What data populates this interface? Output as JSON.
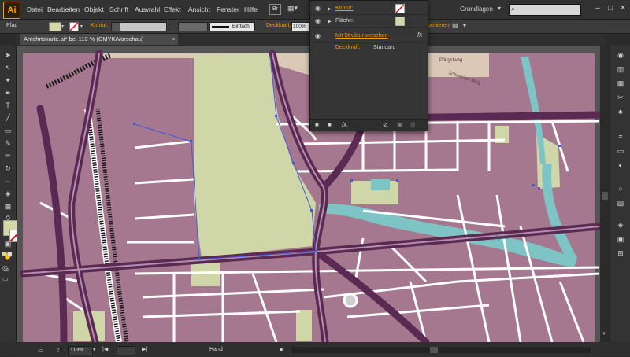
{
  "app": {
    "logo": "Ai"
  },
  "menu": {
    "items": [
      "Datei",
      "Bearbeiten",
      "Objekt",
      "Schrift",
      "Auswahl",
      "Effekt",
      "Ansicht",
      "Fenster",
      "Hilfe"
    ],
    "br_button": "Br",
    "workspace": "Grundlagen",
    "search_placeholder": ""
  },
  "control": {
    "object_type": "Pfad",
    "kontur_label": "Kontur:",
    "stroke_profile": "Einfach",
    "deckkraft_label": "Deckkraft:",
    "deckkraft_value": "100%",
    "trailing_label": "ormieren"
  },
  "document": {
    "tab_title": "Anfahrtskarte.ai* bei 113 % (CMYK/Vorschau)"
  },
  "appearance": {
    "kontur_label": "Kontur:",
    "flaeche_label": "Fläche:",
    "struktur_link": "Mit Struktur versehen",
    "fx_label": "fx",
    "deckkraft_label": "Deckkraft:",
    "deckkraft_value": "Standard",
    "bottom_fx": "fx."
  },
  "map": {
    "street_labels": [
      "Pfingstweg",
      "Schwarzer Weg",
      "Spree"
    ],
    "colors": {
      "built": "#a5788f",
      "park": "#cfd7a8",
      "water": "#7fc4c4",
      "road": "#5a2a52",
      "street": "#ffffff"
    }
  },
  "status": {
    "zoom": "113%",
    "tool": "Hand"
  },
  "colors": {
    "accent": "#ff9a00",
    "fill_swatch": "#d2d9a6"
  }
}
